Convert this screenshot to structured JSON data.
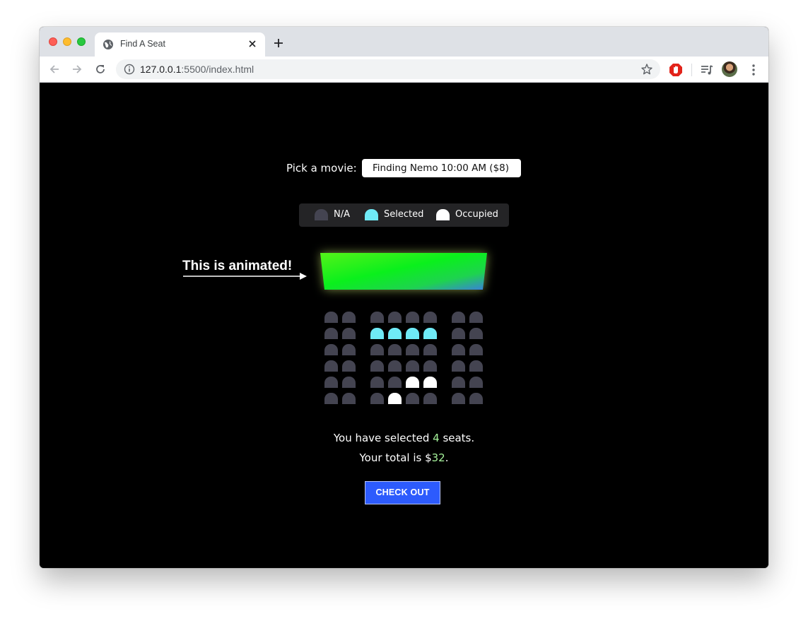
{
  "browser": {
    "tab_title": "Find A Seat",
    "url_host": "127.0.0.1",
    "url_rest": ":5500/index.html"
  },
  "page": {
    "movie_label": "Pick a movie:",
    "movie_selected": "Finding Nemo 10:00 AM ($8)",
    "legend": {
      "na": "N/A",
      "selected": "Selected",
      "occupied": "Occupied"
    },
    "annotation": "This is animated!",
    "summary": {
      "prefix1": "You have selected ",
      "count": "4",
      "suffix1": " seats.",
      "prefix2": "Your total is $",
      "total": "32",
      "suffix2": "."
    },
    "checkout_label": "CHECK OUT",
    "colors": {
      "seat_na": "#444451",
      "seat_selected": "#6feaf6",
      "seat_occupied": "#ffffff",
      "highlight": "#a5f29a",
      "button": "#2d5bfd"
    },
    "seat_rows": [
      [
        "na",
        "na",
        "na",
        "na",
        "na",
        "na",
        "na",
        "na"
      ],
      [
        "na",
        "na",
        "selected",
        "selected",
        "selected",
        "selected",
        "na",
        "na"
      ],
      [
        "na",
        "na",
        "na",
        "na",
        "na",
        "na",
        "na",
        "na"
      ],
      [
        "na",
        "na",
        "na",
        "na",
        "na",
        "na",
        "na",
        "na"
      ],
      [
        "na",
        "na",
        "na",
        "na",
        "occupied",
        "occupied",
        "na",
        "na"
      ],
      [
        "na",
        "na",
        "na",
        "occupied",
        "na",
        "na",
        "na",
        "na"
      ]
    ]
  }
}
